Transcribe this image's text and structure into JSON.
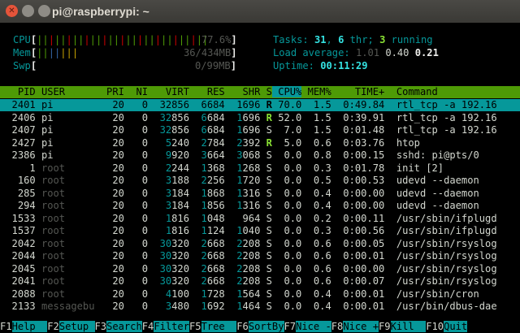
{
  "window": {
    "title": "pi@raspberrypi: ~",
    "close": "✕",
    "minimize": "",
    "maximize": ""
  },
  "meters": {
    "cpu": {
      "label": "CPU",
      "bars": "|||||||||||||||||||||||||||||",
      "value": "77.6%"
    },
    "mem": {
      "label": "Mem",
      "bars": "|||||||",
      "value": "36/434MB"
    },
    "swp": {
      "label": "Swp",
      "bars": "",
      "value": "0/99MB"
    }
  },
  "summary": {
    "tasks_label": "Tasks: ",
    "tasks": "31",
    "sep": ", ",
    "thr": "6",
    "thr_label": " thr; ",
    "running": "3",
    "running_label": " running",
    "load_label": "Load average: ",
    "load1": "1.01",
    "load5": "0.40",
    "load15": "0.21",
    "uptime_label": "Uptime: ",
    "uptime": "00:11:29"
  },
  "columns": [
    "  PID",
    "USER",
    "PRI",
    "NI",
    "VIRT",
    "RES",
    "SHR",
    "S",
    "CPU%",
    "MEM%",
    "TIME+",
    "Command"
  ],
  "processes": [
    {
      "pid": "2401",
      "user": "pi",
      "pri": "20",
      "ni": "0",
      "virt": "32856",
      "res": "6684",
      "shr": "1696",
      "s": "R",
      "cpu": "70.0",
      "mem": "1.5",
      "time": "0:49.84",
      "cmd": "rtl_tcp -a 192.16"
    },
    {
      "pid": "2406",
      "user": "pi",
      "pri": "20",
      "ni": "0",
      "virt": "32856",
      "res": "6684",
      "shr": "1696",
      "s": "R",
      "cpu": "52.0",
      "mem": "1.5",
      "time": "0:39.91",
      "cmd": "rtl_tcp -a 192.16"
    },
    {
      "pid": "2407",
      "user": "pi",
      "pri": "20",
      "ni": "0",
      "virt": "32856",
      "res": "6684",
      "shr": "1696",
      "s": "S",
      "cpu": "7.0",
      "mem": "1.5",
      "time": "0:01.48",
      "cmd": "rtl_tcp -a 192.16"
    },
    {
      "pid": "2427",
      "user": "pi",
      "pri": "20",
      "ni": "0",
      "virt": "5240",
      "res": "2784",
      "shr": "2392",
      "s": "R",
      "cpu": "5.0",
      "mem": "0.6",
      "time": "0:03.76",
      "cmd": "htop"
    },
    {
      "pid": "2386",
      "user": "pi",
      "pri": "20",
      "ni": "0",
      "virt": "9920",
      "res": "3664",
      "shr": "3068",
      "s": "S",
      "cpu": "0.0",
      "mem": "0.8",
      "time": "0:00.15",
      "cmd": "sshd: pi@pts/0"
    },
    {
      "pid": "1",
      "user": "root",
      "pri": "20",
      "ni": "0",
      "virt": "2244",
      "res": "1368",
      "shr": "1268",
      "s": "S",
      "cpu": "0.0",
      "mem": "0.3",
      "time": "0:01.78",
      "cmd": "init [2]"
    },
    {
      "pid": "160",
      "user": "root",
      "pri": "20",
      "ni": "0",
      "virt": "3188",
      "res": "2256",
      "shr": "1720",
      "s": "S",
      "cpu": "0.0",
      "mem": "0.5",
      "time": "0:00.53",
      "cmd": "udevd --daemon"
    },
    {
      "pid": "285",
      "user": "root",
      "pri": "20",
      "ni": "0",
      "virt": "3184",
      "res": "1868",
      "shr": "1316",
      "s": "S",
      "cpu": "0.0",
      "mem": "0.4",
      "time": "0:00.00",
      "cmd": "udevd --daemon"
    },
    {
      "pid": "294",
      "user": "root",
      "pri": "20",
      "ni": "0",
      "virt": "3184",
      "res": "1856",
      "shr": "1316",
      "s": "S",
      "cpu": "0.0",
      "mem": "0.4",
      "time": "0:00.00",
      "cmd": "udevd --daemon"
    },
    {
      "pid": "1533",
      "user": "root",
      "pri": "20",
      "ni": "0",
      "virt": "1816",
      "res": "1048",
      "shr": "964",
      "s": "S",
      "cpu": "0.0",
      "mem": "0.2",
      "time": "0:00.11",
      "cmd": "/usr/sbin/ifplugd"
    },
    {
      "pid": "1537",
      "user": "root",
      "pri": "20",
      "ni": "0",
      "virt": "1816",
      "res": "1124",
      "shr": "1040",
      "s": "S",
      "cpu": "0.0",
      "mem": "0.3",
      "time": "0:00.56",
      "cmd": "/usr/sbin/ifplugd"
    },
    {
      "pid": "2042",
      "user": "root",
      "pri": "20",
      "ni": "0",
      "virt": "30320",
      "res": "2668",
      "shr": "2208",
      "s": "S",
      "cpu": "0.0",
      "mem": "0.6",
      "time": "0:00.05",
      "cmd": "/usr/sbin/rsyslog"
    },
    {
      "pid": "2044",
      "user": "root",
      "pri": "20",
      "ni": "0",
      "virt": "30320",
      "res": "2668",
      "shr": "2208",
      "s": "S",
      "cpu": "0.0",
      "mem": "0.6",
      "time": "0:00.01",
      "cmd": "/usr/sbin/rsyslog"
    },
    {
      "pid": "2045",
      "user": "root",
      "pri": "20",
      "ni": "0",
      "virt": "30320",
      "res": "2668",
      "shr": "2208",
      "s": "S",
      "cpu": "0.0",
      "mem": "0.6",
      "time": "0:00.00",
      "cmd": "/usr/sbin/rsyslog"
    },
    {
      "pid": "2041",
      "user": "root",
      "pri": "20",
      "ni": "0",
      "virt": "30320",
      "res": "2668",
      "shr": "2208",
      "s": "S",
      "cpu": "0.0",
      "mem": "0.6",
      "time": "0:00.07",
      "cmd": "/usr/sbin/rsyslog"
    },
    {
      "pid": "2088",
      "user": "root",
      "pri": "20",
      "ni": "0",
      "virt": "4100",
      "res": "1728",
      "shr": "1564",
      "s": "S",
      "cpu": "0.0",
      "mem": "0.4",
      "time": "0:00.01",
      "cmd": "/usr/sbin/cron"
    },
    {
      "pid": "2133",
      "user": "messagebu",
      "pri": "20",
      "ni": "0",
      "virt": "3480",
      "res": "1692",
      "shr": "1464",
      "s": "S",
      "cpu": "0.0",
      "mem": "0.4",
      "time": "0:00.01",
      "cmd": "/usr/bin/dbus-dae"
    }
  ],
  "function_keys": [
    {
      "key": "F1",
      "label": "Help  "
    },
    {
      "key": "F2",
      "label": "Setup "
    },
    {
      "key": "F3",
      "label": "Search"
    },
    {
      "key": "F4",
      "label": "Filter"
    },
    {
      "key": "F5",
      "label": "Tree  "
    },
    {
      "key": "F6",
      "label": "SortBy"
    },
    {
      "key": "F7",
      "label": "Nice -"
    },
    {
      "key": "F8",
      "label": "Nice +"
    },
    {
      "key": "F9",
      "label": "Kill  "
    },
    {
      "key": "F10",
      "label": "Quit"
    }
  ],
  "colors": {
    "header_bg": "#4e9a06",
    "selected_bg": "#06989a",
    "term_bg": "#000000"
  }
}
